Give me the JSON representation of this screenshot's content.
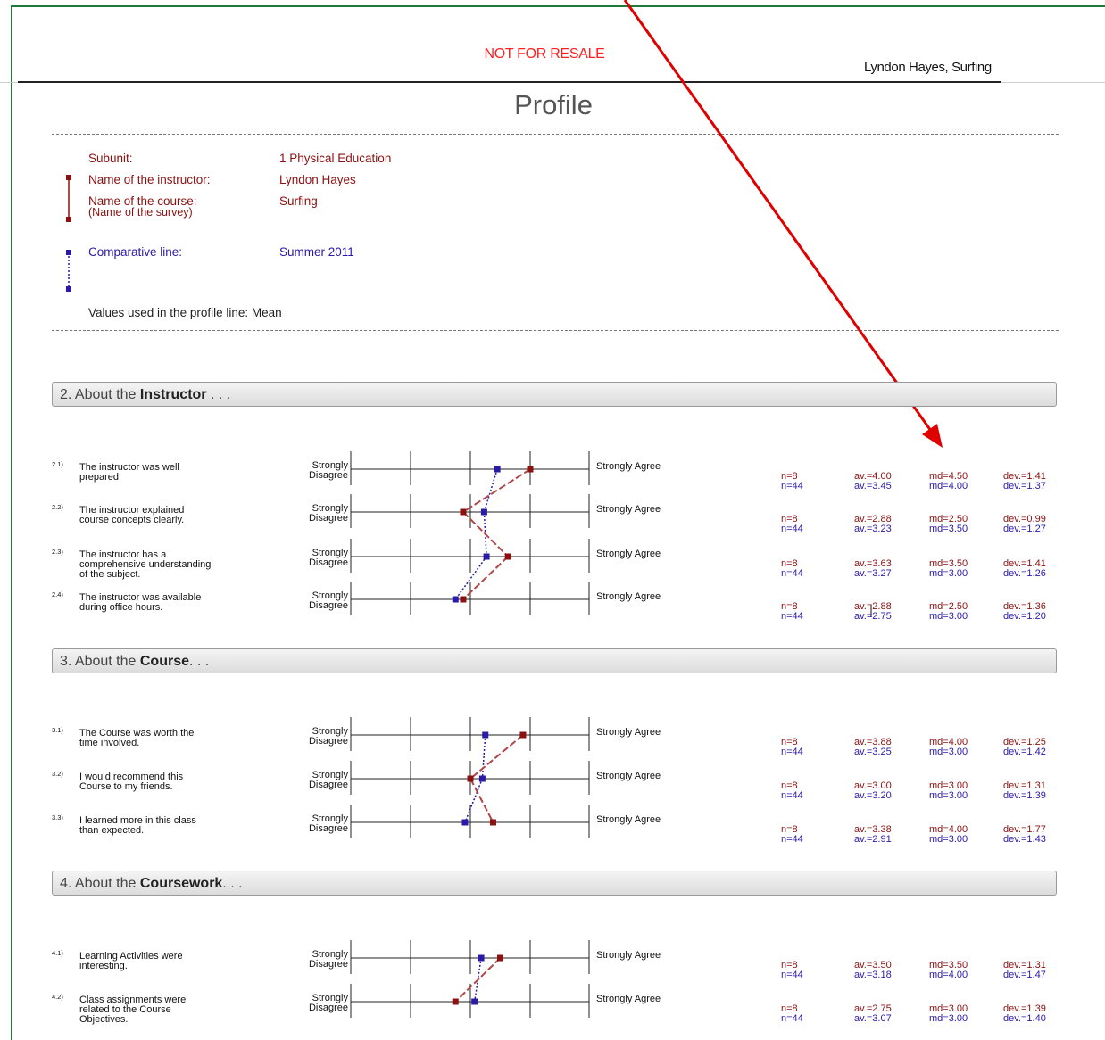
{
  "header": {
    "not_for_resale": "NOT FOR RESALE",
    "instructor_course": "Lyndon Hayes, Surfing",
    "title": "Profile"
  },
  "info": {
    "subunit_label": "Subunit:",
    "subunit_value": "1 Physical Education",
    "instructor_label": "Name of the instructor:",
    "instructor_value": "Lyndon Hayes",
    "course_label": "Name of the course:",
    "course_label2": "(Name of the survey)",
    "course_value": "Surfing",
    "comparative_label": "Comparative line:",
    "comparative_value": "Summer 2011",
    "values_used": "Values used in the profile line: Mean"
  },
  "scale": {
    "left": "Strongly",
    "left2": "Disagree",
    "right": "Strongly Agree"
  },
  "colors": {
    "primary": "#8b1010",
    "comparative": "#2a1aa8"
  },
  "sections": [
    {
      "prefix": "2. About the ",
      "bold": "Instructor",
      "suffix": " . . .",
      "questions": [
        {
          "num": "2.1)",
          "text": [
            "The instructor was well",
            "prepared."
          ],
          "av1": 4.0,
          "av2": 3.45,
          "s1": [
            "n=8",
            "av.=4.00",
            "md=4.50",
            "dev.=1.41"
          ],
          "s2": [
            "n=44",
            "av.=3.45",
            "md=4.00",
            "dev.=1.37"
          ]
        },
        {
          "num": "2.2)",
          "text": [
            "The instructor explained",
            "course concepts clearly."
          ],
          "av1": 2.88,
          "av2": 3.23,
          "s1": [
            "n=8",
            "av.=2.88",
            "md=2.50",
            "dev.=0.99"
          ],
          "s2": [
            "n=44",
            "av.=3.23",
            "md=3.50",
            "dev.=1.27"
          ]
        },
        {
          "num": "2.3)",
          "text": [
            "The instructor has a",
            "comprehensive understanding",
            "of the subject."
          ],
          "av1": 3.63,
          "av2": 3.27,
          "s1": [
            "n=8",
            "av.=3.63",
            "md=3.50",
            "dev.=1.41"
          ],
          "s2": [
            "n=44",
            "av.=3.27",
            "md=3.00",
            "dev.=1.26"
          ]
        },
        {
          "num": "2.4)",
          "text": [
            "The instructor was available",
            "during office hours."
          ],
          "av1": 2.88,
          "av2": 2.75,
          "s1": [
            "n=8",
            "av.=2.88",
            "md=2.50",
            "dev.=1.36"
          ],
          "s2": [
            "n=44",
            "av.=2.75",
            "md=3.00",
            "dev.=1.20"
          ]
        }
      ]
    },
    {
      "prefix": "3. About the ",
      "bold": "Course",
      "suffix": ". . .",
      "questions": [
        {
          "num": "3.1)",
          "text": [
            "The Course was worth the",
            "time involved."
          ],
          "av1": 3.88,
          "av2": 3.25,
          "s1": [
            "n=8",
            "av.=3.88",
            "md=4.00",
            "dev.=1.25"
          ],
          "s2": [
            "n=44",
            "av.=3.25",
            "md=3.00",
            "dev.=1.42"
          ]
        },
        {
          "num": "3.2)",
          "text": [
            "I would recommend this",
            "Course to my friends."
          ],
          "av1": 3.0,
          "av2": 3.2,
          "s1": [
            "n=8",
            "av.=3.00",
            "md=3.00",
            "dev.=1.31"
          ],
          "s2": [
            "n=44",
            "av.=3.20",
            "md=3.00",
            "dev.=1.39"
          ]
        },
        {
          "num": "3.3)",
          "text": [
            "I learned more in this class",
            "than expected."
          ],
          "av1": 3.38,
          "av2": 2.91,
          "s1": [
            "n=8",
            "av.=3.38",
            "md=4.00",
            "dev.=1.77"
          ],
          "s2": [
            "n=44",
            "av.=2.91",
            "md=3.00",
            "dev.=1.43"
          ]
        }
      ]
    },
    {
      "prefix": "4. About the ",
      "bold": "Coursework",
      "suffix": ". . .",
      "questions": [
        {
          "num": "4.1)",
          "text": [
            "Learning Activities were",
            "interesting."
          ],
          "av1": 3.5,
          "av2": 3.18,
          "s1": [
            "n=8",
            "av.=3.50",
            "md=3.50",
            "dev.=1.31"
          ],
          "s2": [
            "n=44",
            "av.=3.18",
            "md=4.00",
            "dev.=1.47"
          ]
        },
        {
          "num": "4.2)",
          "text": [
            "Class assignments were",
            "related to the Course",
            "Objectives."
          ],
          "av1": 2.75,
          "av2": 3.07,
          "s1": [
            "n=8",
            "av.=2.75",
            "md=3.00",
            "dev.=1.39"
          ],
          "s2": [
            "n=44",
            "av.=3.07",
            "md=3.00",
            "dev.=1.40"
          ]
        }
      ]
    }
  ]
}
